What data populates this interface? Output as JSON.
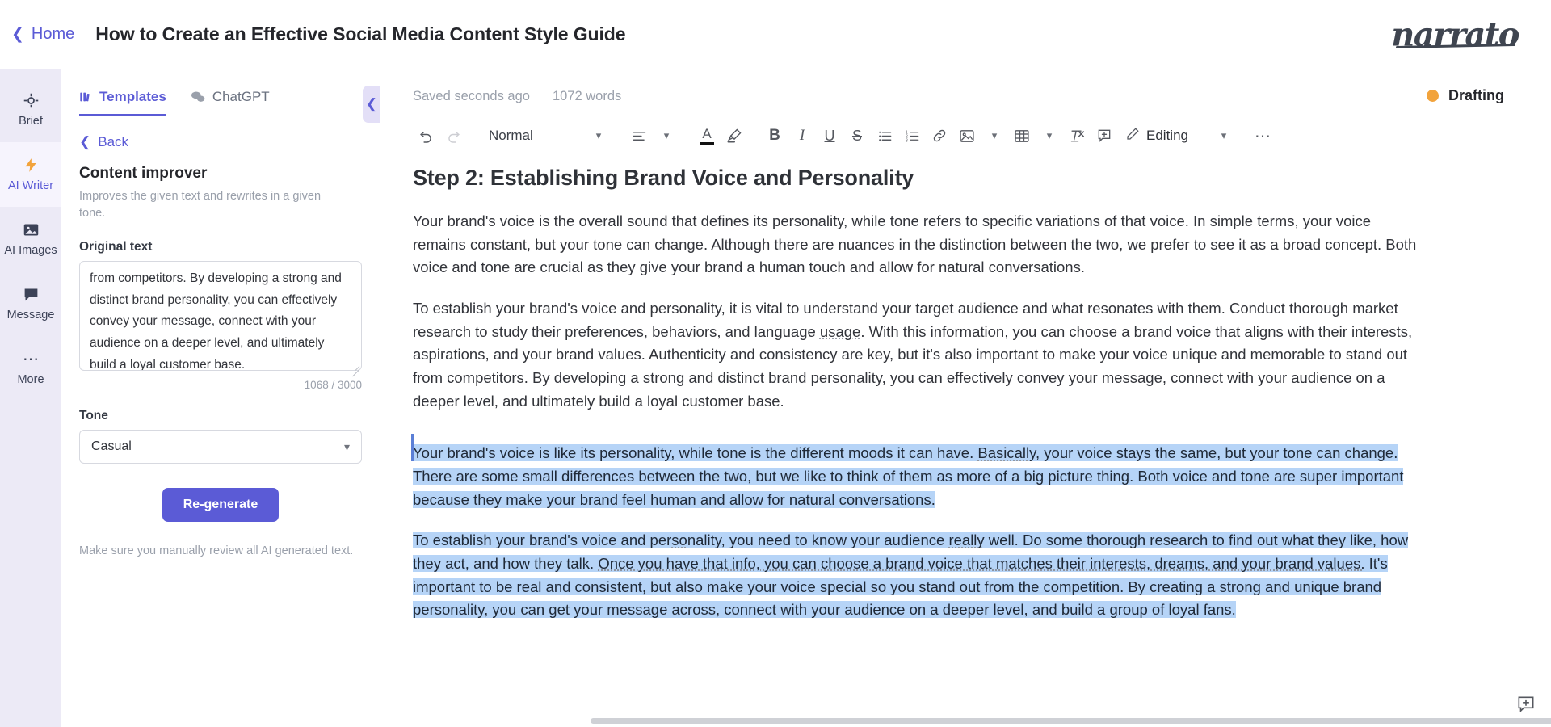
{
  "topbar": {
    "home_label": "Home",
    "home_icon": "chevron-left-icon",
    "doc_title": "How to Create an Effective Social Media Content Style Guide",
    "brand": "narrato"
  },
  "rail": {
    "items": [
      {
        "label": "Brief",
        "icon": "target-icon",
        "active": false
      },
      {
        "label": "AI Writer",
        "icon": "lightning-icon",
        "active": true
      },
      {
        "label": "AI Images",
        "icon": "image-icon",
        "active": false
      },
      {
        "label": "Message",
        "icon": "chat-icon",
        "active": false
      },
      {
        "label": "More",
        "icon": "ellipsis-icon",
        "active": false
      }
    ]
  },
  "panel": {
    "tabs": [
      {
        "label": "Templates",
        "icon": "books-icon",
        "active": true
      },
      {
        "label": "ChatGPT",
        "icon": "chat-bubbles-icon",
        "active": false
      }
    ],
    "collapse_icon": "chevron-left-icon",
    "back_label": "Back",
    "back_icon": "chevron-left-icon",
    "template_title": "Content improver",
    "template_desc": "Improves the given text and rewrites in a given tone.",
    "original_text_label": "Original text",
    "original_text_value": "from competitors. By developing a strong and distinct brand personality, you can effectively convey your message, connect with your audience on a deeper level, and ultimately build a loyal customer base.",
    "counter": "1068 / 3000",
    "tone_label": "Tone",
    "tone_value": "Casual",
    "tone_caret": "chevron-down-icon",
    "regenerate_label": "Re-generate",
    "disclaimer": "Make sure you manually review all AI generated text."
  },
  "editor": {
    "saved_status": "Saved seconds ago",
    "word_count": "1072 words",
    "doc_state": "Drafting",
    "doc_state_color": "#f2a33c",
    "toolbar": {
      "undo": "undo-icon",
      "redo": "redo-icon",
      "style_value": "Normal",
      "style_caret": "chevron-down-icon",
      "align": "align-left-icon",
      "align_caret": "chevron-down-icon",
      "font_color": "text-color-icon",
      "highlight": "highlighter-icon",
      "bold": "B",
      "italic": "I",
      "underline": "U",
      "strikethrough": "S",
      "bullet_list": "bullet-list-icon",
      "numbered_list": "numbered-list-icon",
      "link": "link-icon",
      "image": "image-icon",
      "image_caret": "chevron-down-icon",
      "table": "table-icon",
      "table_caret": "chevron-down-icon",
      "clear_format": "clear-format-icon",
      "comment": "add-comment-icon",
      "mode_icon": "pencil-icon",
      "mode_label": "Editing",
      "mode_caret": "chevron-down-icon",
      "more": "ellipsis-icon"
    },
    "document": {
      "heading": "Step 2: Establishing Brand Voice and Personality",
      "paragraphs": [
        "Your brand's voice is the overall sound that defines its personality, while tone refers to specific variations of that voice. In simple terms, your voice remains constant, but your tone can change. Although there are nuances in the distinction between the two, we prefer to see it as a broad concept. Both voice and tone are crucial as they give your brand a human touch and allow for natural conversations.",
        "To establish your brand's voice and personality, it is vital to understand your target audience and what resonates with them. Conduct thorough market research to study their preferences, behaviors, and language usage. With this information, you can choose a brand voice that aligns with their interests, aspirations, and your brand values. Authenticity and consistency are key, but it's also important to make your voice unique and memorable to stand out from competitors. By developing a strong and distinct brand personality, you can effectively convey your message, connect with your audience on a deeper level, and ultimately build a loyal customer base."
      ],
      "selected_paragraphs": [
        "Your brand's voice is like its personality, while tone is the different moods it can have. Basically, your voice stays the same, but your tone can change. There are some small differences between the two, but we like to think of them as more of a big picture thing. Both voice and tone are super important because they make your brand feel human and allow for natural conversations.",
        "To establish your brand's voice and personality, you need to know your audience really well. Do some thorough research to find out what they like, how they act, and how they talk. Once you have that info, you can choose a brand voice that matches their interests, dreams, and your brand values. It's important to be real and consistent, but also make your voice special so you stand out from the competition. By creating a strong and unique brand personality, you can get your message across, connect with your audience on a deeper level, and build a group of loyal fans."
      ],
      "comment_icon": "add-comment-icon"
    }
  }
}
